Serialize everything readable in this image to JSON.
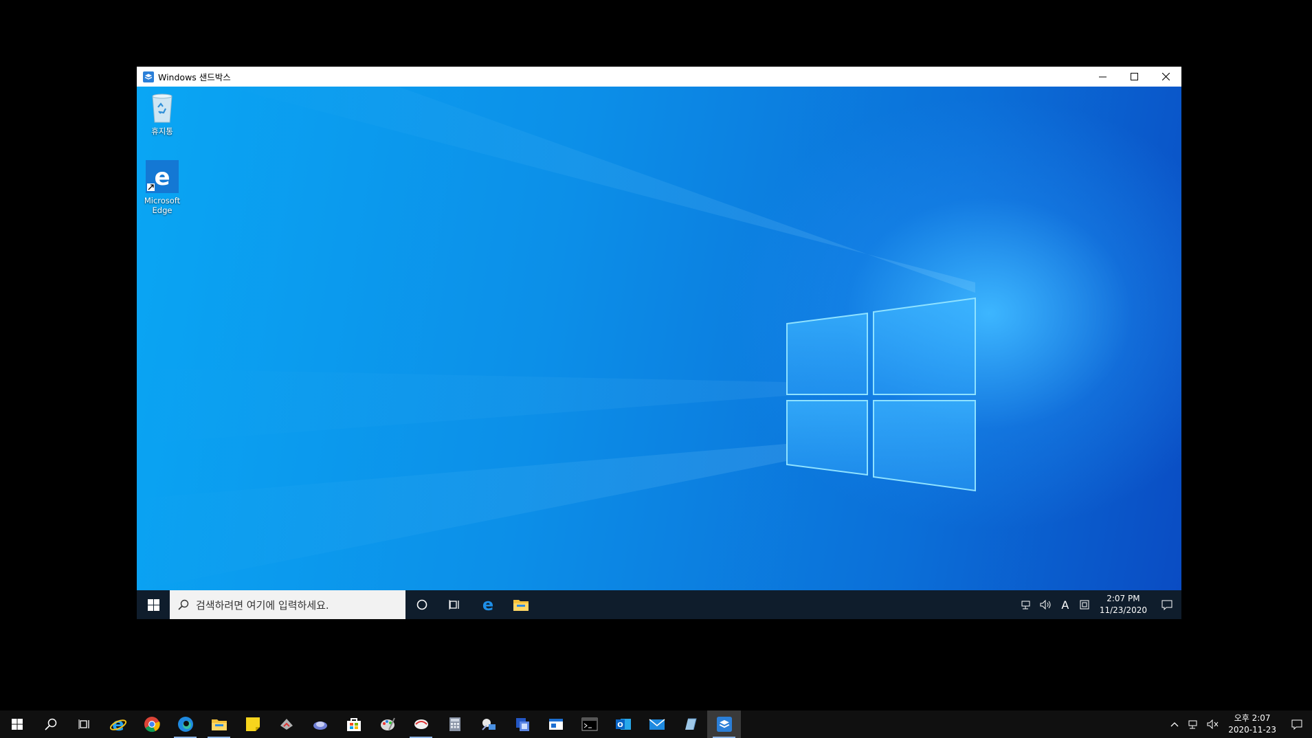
{
  "window": {
    "title": "Windows 샌드박스",
    "controls": [
      "minimize",
      "maximize",
      "close"
    ]
  },
  "desktop": {
    "icons": [
      {
        "name": "recycle-bin",
        "label": "휴지통"
      },
      {
        "name": "microsoft-edge",
        "label": "Microsoft Edge"
      }
    ]
  },
  "inner_taskbar": {
    "search_placeholder": "검색하려면 여기에 입력하세요.",
    "pinned": [
      "cortana-icon",
      "task-view-icon",
      "edge-legacy-icon",
      "file-explorer-icon"
    ],
    "tray": {
      "ime": "A",
      "time": "2:07 PM",
      "date": "11/23/2020"
    }
  },
  "outer_taskbar": {
    "apps": [
      "internet-explorer-icon",
      "chrome-icon",
      "edge-icon",
      "file-explorer-icon",
      "sticky-notes-icon",
      "app-icon",
      "app-icon",
      "store-icon",
      "paint-icon",
      "app-icon",
      "calculator-icon",
      "app-icon",
      "app-icon",
      "app-icon",
      "terminal-icon",
      "outlook-icon",
      "mail-icon",
      "app-icon",
      "windows-sandbox-icon"
    ],
    "tray": {
      "time": "오후 2:07",
      "date": "2020-11-23"
    }
  },
  "colors": {
    "desktop_blue": "#0a8fe8",
    "taskbar_inner": "#0f1d2c",
    "taskbar_outer": "#101010"
  }
}
